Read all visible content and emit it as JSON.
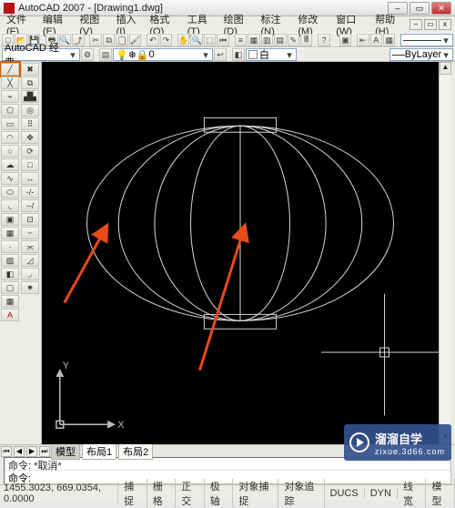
{
  "window": {
    "title": "AutoCAD 2007 - [Drawing1.dwg]",
    "menus": [
      "文件(F)",
      "编辑(E)",
      "视图(V)",
      "插入(I)",
      "格式(O)",
      "工具(T)",
      "绘图(D)",
      "标注(N)",
      "修改(M)",
      "窗口(W)",
      "帮助(H)"
    ]
  },
  "workspace_combo": "AutoCAD 经典",
  "layer_combo": "0",
  "color_combo": "白",
  "linetype_combo": "ByLayer",
  "layout_tabs": {
    "model": "模型",
    "l1": "布局1",
    "l2": "布局2"
  },
  "command": {
    "history": "命令: *取消*",
    "prompt": "命令:"
  },
  "status": {
    "coord": "1455.3023, 669.0354, 0.0000",
    "toggles": [
      "捕捉",
      "栅格",
      "正交",
      "极轴",
      "对象捕捉",
      "对象追踪",
      "DUCS",
      "DYN",
      "线宽",
      "模型"
    ]
  },
  "ucs_labels": {
    "x": "X",
    "y": "Y"
  },
  "watermark": {
    "big": "溜溜自学",
    "small": "zixue.3d66.com"
  }
}
